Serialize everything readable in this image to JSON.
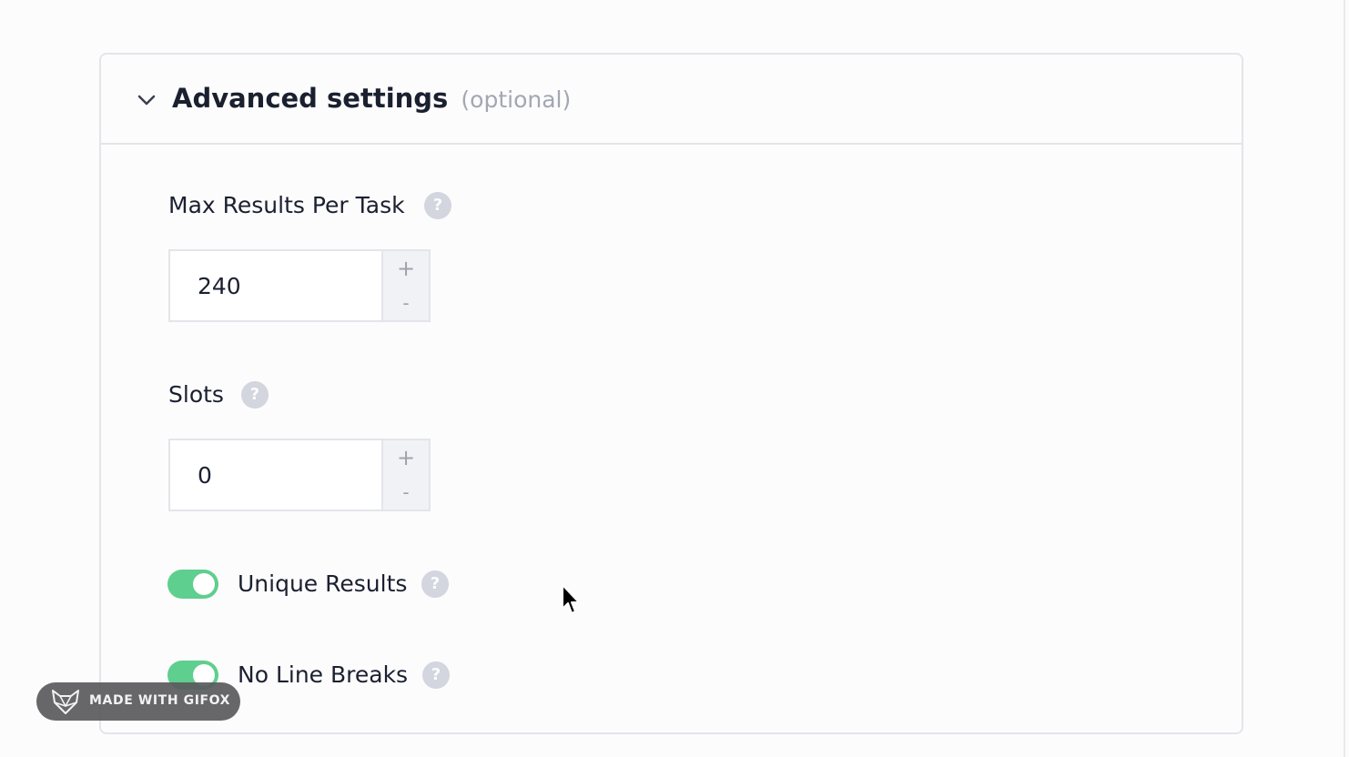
{
  "panel": {
    "title": "Advanced settings",
    "title_suffix": "(optional)",
    "expanded": true
  },
  "fields": [
    {
      "label": "Max Results Per Task",
      "value": "240",
      "help": "?",
      "increment": "+",
      "decrement": "-"
    },
    {
      "label": "Slots",
      "value": "0",
      "help": "?",
      "increment": "+",
      "decrement": "-"
    }
  ],
  "toggles": [
    {
      "label": "Unique Results",
      "enabled": true,
      "help": "?"
    },
    {
      "label": "No Line Breaks",
      "enabled": true,
      "help": "?"
    }
  ],
  "watermark": {
    "text": "MADE WITH GIFOX",
    "icon": "fox-logo-icon"
  },
  "colors": {
    "toggle_on": "#5ecf8e",
    "help_icon": "#d3d5df",
    "border": "#e4e5ea",
    "text": "#1b2030",
    "muted": "#a3a7b3"
  }
}
